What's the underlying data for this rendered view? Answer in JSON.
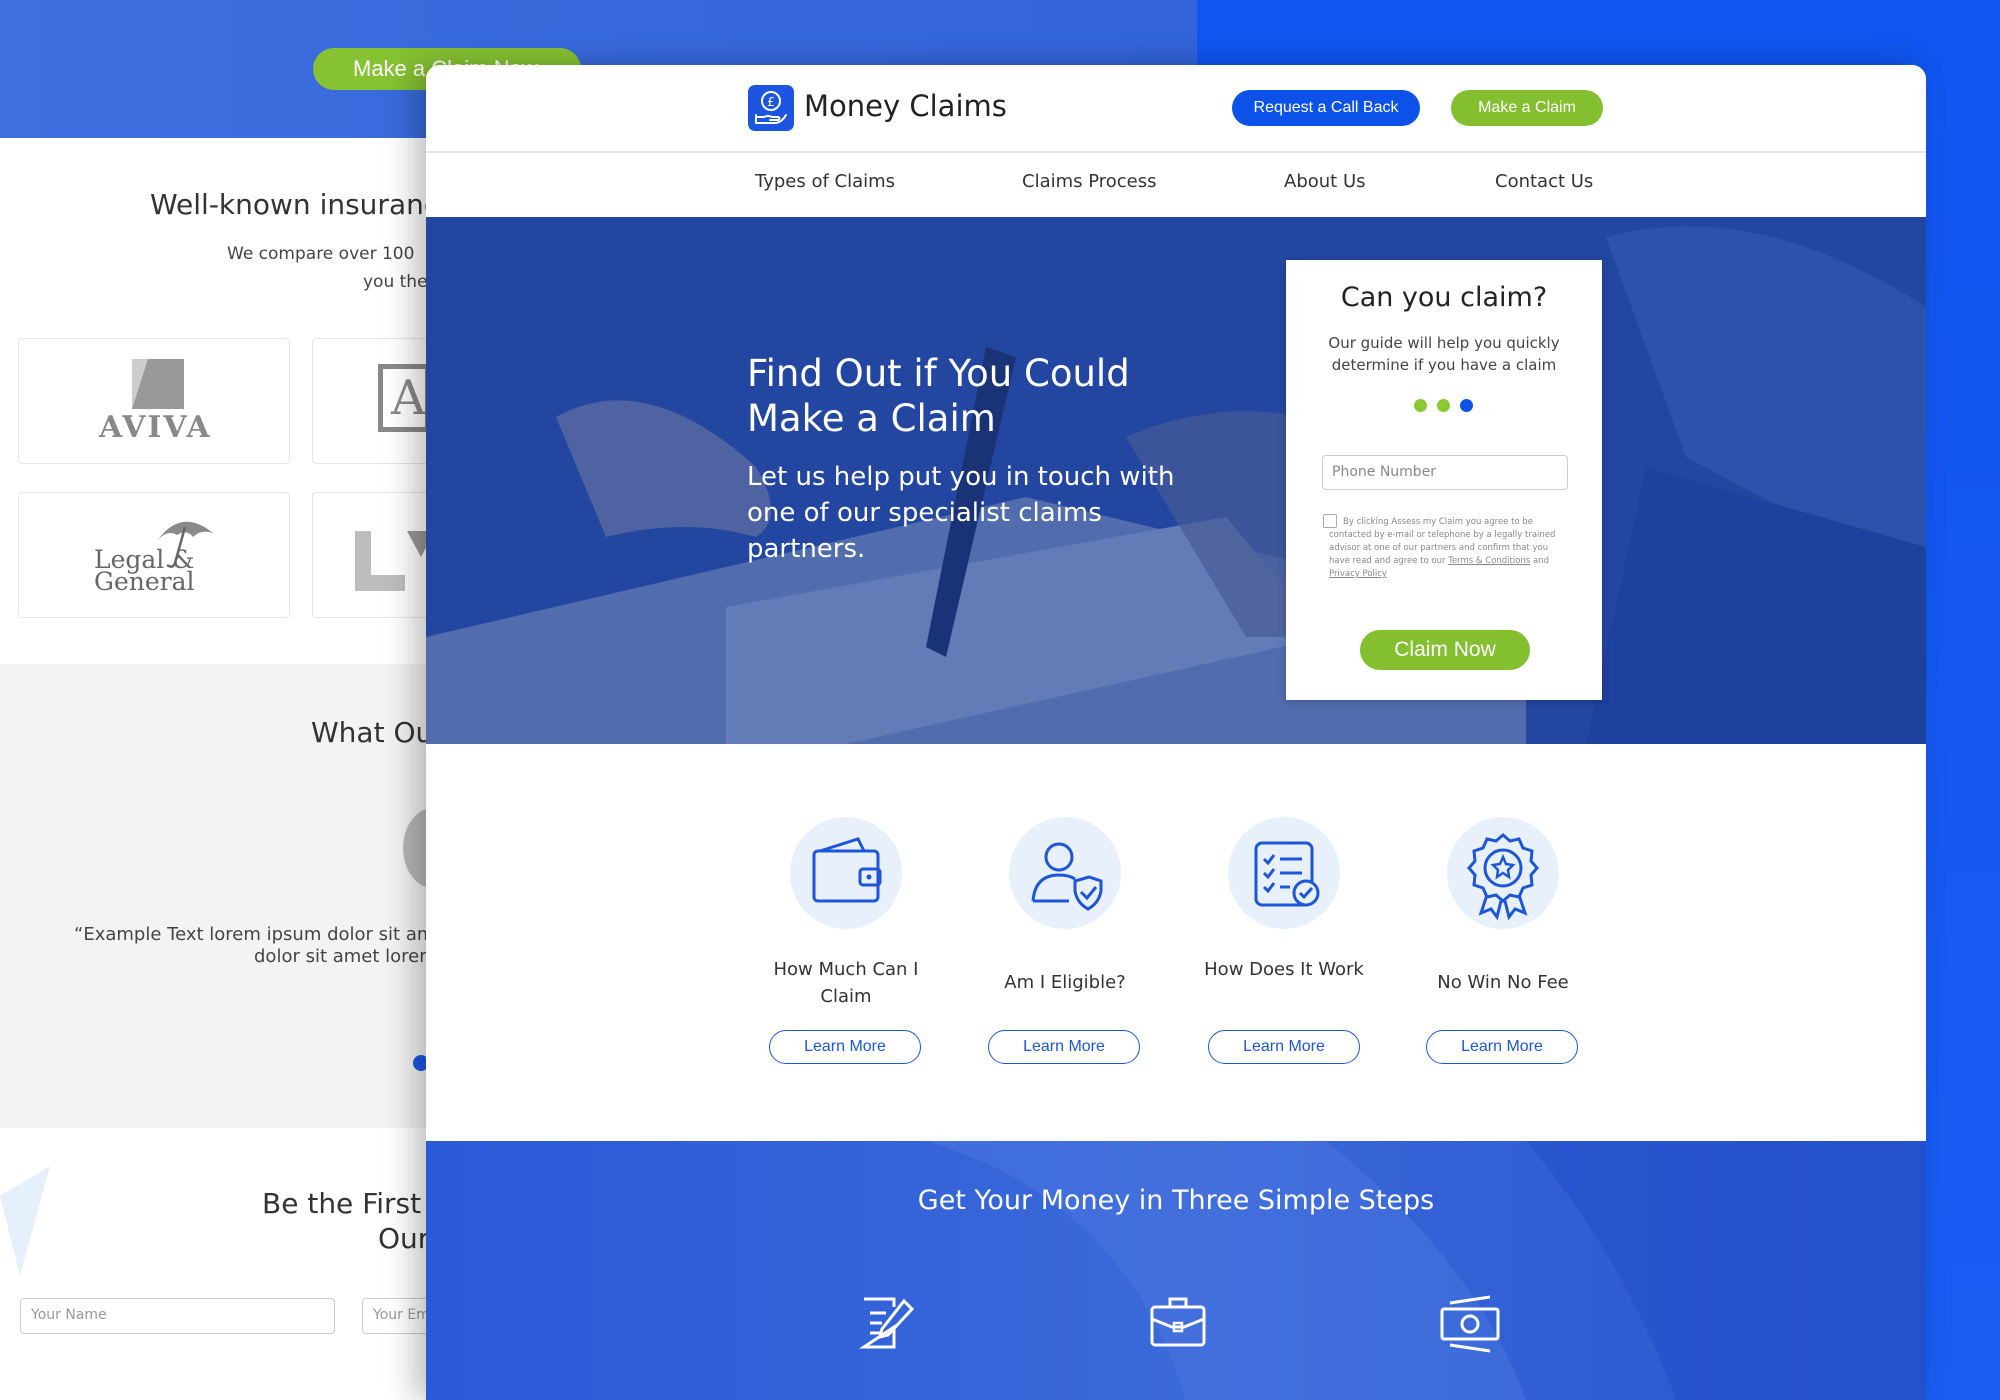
{
  "background_page": {
    "hero_button": "Make a Claim Now",
    "insurers_title": "Well-known insuranc",
    "insurers_text_1": "We compare over 100",
    "insurers_text_2": "you the",
    "logos": [
      "AVIVA",
      "Legal & General"
    ],
    "reviews_title": "What Ou",
    "quote_1": "“Example Text lorem ipsum dolor sit am",
    "quote_2": "dolor sit amet lorem",
    "newsletter_title_1": "Be the First",
    "newsletter_title_2": "Our",
    "name_placeholder": "Your Name",
    "email_placeholder": "Your Em"
  },
  "header": {
    "brand": "Money Claims",
    "callback_button": "Request a Call Back",
    "claim_button": "Make a Claim"
  },
  "nav": [
    "Types of Claims",
    "Claims Process",
    "About Us",
    "Contact Us"
  ],
  "hero": {
    "title": "Find Out if You Could Make a Claim",
    "subtitle": "Let us help put you in touch with one of our specialist claims partners."
  },
  "claim_form": {
    "title": "Can you claim?",
    "subtitle": "Our guide will help you quickly determine if you have a claim",
    "step_dots": [
      "#8bc832",
      "#8bc832",
      "#0d52e8"
    ],
    "phone_placeholder": "Phone Number",
    "terms_text": "By clicking Assess my Claim you agree to be contacted by e-mail or telephone by a legally trained advisor at one of our partners and confirm that you have read and agree to our",
    "terms_link": "Terms & Conditions",
    "terms_and": "and",
    "privacy_link": "Privacy Policy",
    "submit": "Claim Now"
  },
  "features": [
    {
      "icon": "wallet-icon",
      "label": "How Much Can I Claim",
      "button": "Learn More"
    },
    {
      "icon": "user-shield-icon",
      "label": "Am I Eligible?",
      "button": "Learn More"
    },
    {
      "icon": "checklist-icon",
      "label": "How Does It Work",
      "button": "Learn More"
    },
    {
      "icon": "award-badge-icon",
      "label": "No Win No Fee",
      "button": "Learn More"
    }
  ],
  "steps": {
    "title": "Get Your Money in Three Simple Steps",
    "icons": [
      "edit-document-icon",
      "briefcase-icon",
      "cash-icon"
    ]
  },
  "colors": {
    "brand_blue": "#0d52e8",
    "accent_green": "#83bf2f"
  }
}
